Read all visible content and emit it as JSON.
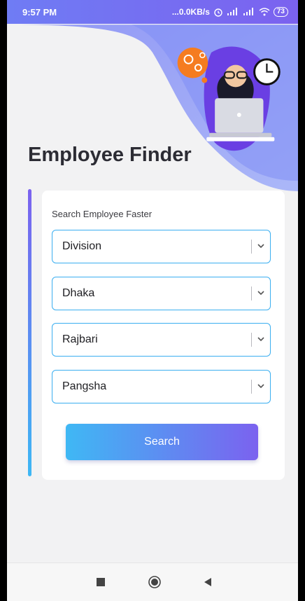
{
  "status_bar": {
    "time": "9:57 PM",
    "net_speed": "...0.0KB/s",
    "battery": "73"
  },
  "app": {
    "title": "Employee Finder"
  },
  "form": {
    "heading": "Search Employee Faster",
    "selects": [
      {
        "value": "Division"
      },
      {
        "value": "Dhaka"
      },
      {
        "value": "Rajbari"
      },
      {
        "value": "Pangsha"
      }
    ],
    "search_label": "Search"
  },
  "icons": {
    "alarm": "alarm-icon",
    "signal": "signal-icon",
    "wifi": "wifi-icon",
    "chevron": "chevron-down-icon",
    "nav_recent": "square-icon",
    "nav_home": "circle-icon",
    "nav_back": "triangle-back-icon"
  },
  "colors": {
    "accent_purple": "#7b62ef",
    "accent_blue": "#3fb8f4",
    "background": "#f2f2f3"
  }
}
